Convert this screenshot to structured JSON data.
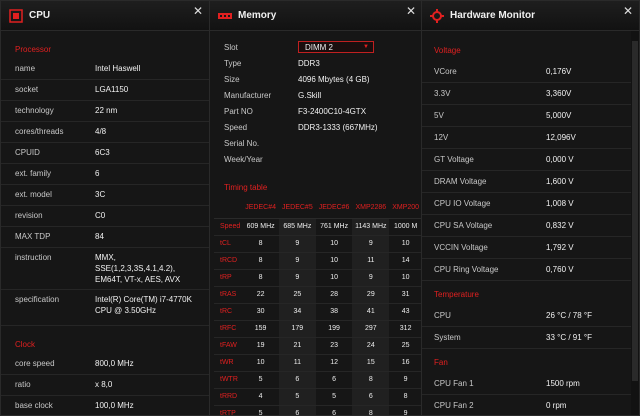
{
  "cpu": {
    "title": "CPU",
    "processor_section": "Processor",
    "rows": [
      {
        "key": "name",
        "value": "Intel Haswell"
      },
      {
        "key": "socket",
        "value": "LGA1150"
      },
      {
        "key": "technology",
        "value": "22 nm"
      },
      {
        "key": "cores/threads",
        "value": "4/8"
      },
      {
        "key": "CPUID",
        "value": "6C3"
      },
      {
        "key": "ext. family",
        "value": "6"
      },
      {
        "key": "ext. model",
        "value": "3C"
      },
      {
        "key": "revision",
        "value": "C0"
      },
      {
        "key": "MAX TDP",
        "value": "84"
      },
      {
        "key": "instruction",
        "value": "MMX, SSE(1,2,3,3S,4.1,4.2), EM64T, VT-x, AES, AVX"
      },
      {
        "key": "specification",
        "value": "Intel(R) Core(TM) i7-4770K CPU @ 3.50GHz"
      }
    ],
    "clock_section": "Clock",
    "clock_rows": [
      {
        "key": "core speed",
        "value": "800,0 MHz"
      },
      {
        "key": "ratio",
        "value": "x 8,0"
      },
      {
        "key": "base clock",
        "value": "100,0 MHz"
      }
    ]
  },
  "memory": {
    "title": "Memory",
    "slot_label": "Slot",
    "slot_value": "DIMM 2",
    "rows": [
      {
        "key": "Type",
        "value": "DDR3"
      },
      {
        "key": "Size",
        "value": "4096 Mbytes (4 GB)"
      },
      {
        "key": "Manufacturer",
        "value": "G.Skill"
      },
      {
        "key": "Part NO",
        "value": "F3-2400C10-4GTX"
      },
      {
        "key": "Speed",
        "value": "DDR3-1333 (667MHz)"
      },
      {
        "key": "Serial No.",
        "value": ""
      },
      {
        "key": "Week/Year",
        "value": ""
      }
    ],
    "timing_section": "Timing table",
    "timing_headers": [
      "",
      "JEDEC#4",
      "JEDEC#5",
      "JEDEC#6",
      "XMP2286",
      "XMP200"
    ],
    "timing_rows": [
      {
        "label": "Speed",
        "values": [
          "609 MHz",
          "685 MHz",
          "761 MHz",
          "1143 MHz",
          "1000 M"
        ]
      },
      {
        "label": "tCL",
        "values": [
          "8",
          "9",
          "10",
          "9",
          "10"
        ]
      },
      {
        "label": "tRCD",
        "values": [
          "8",
          "9",
          "10",
          "11",
          "14"
        ]
      },
      {
        "label": "tRP",
        "values": [
          "8",
          "9",
          "10",
          "9",
          "10"
        ]
      },
      {
        "label": "tRAS",
        "values": [
          "22",
          "25",
          "28",
          "29",
          "31"
        ]
      },
      {
        "label": "tRC",
        "values": [
          "30",
          "34",
          "38",
          "41",
          "43"
        ]
      },
      {
        "label": "tRFC",
        "values": [
          "159",
          "179",
          "199",
          "297",
          "312"
        ]
      },
      {
        "label": "tFAW",
        "values": [
          "19",
          "21",
          "23",
          "24",
          "25"
        ]
      },
      {
        "label": "tWR",
        "values": [
          "10",
          "11",
          "12",
          "15",
          "16"
        ]
      },
      {
        "label": "tWTR",
        "values": [
          "5",
          "6",
          "6",
          "8",
          "9"
        ]
      },
      {
        "label": "tRRD",
        "values": [
          "4",
          "5",
          "5",
          "6",
          "8"
        ]
      },
      {
        "label": "tRTP",
        "values": [
          "5",
          "6",
          "6",
          "8",
          "9"
        ]
      }
    ]
  },
  "hw": {
    "title": "Hardware Monitor",
    "voltage_section": "Voltage",
    "voltage_rows": [
      {
        "key": "VCore",
        "value": "0,176V"
      },
      {
        "key": "3.3V",
        "value": "3,360V"
      },
      {
        "key": "5V",
        "value": "5,000V"
      },
      {
        "key": "12V",
        "value": "12,096V"
      },
      {
        "key": "GT Voltage",
        "value": "0,000 V"
      },
      {
        "key": "DRAM Voltage",
        "value": "1,600 V"
      },
      {
        "key": "CPU IO Voltage",
        "value": "1,008 V"
      },
      {
        "key": "CPU SA Voltage",
        "value": "0,832 V"
      },
      {
        "key": "VCCIN Voltage",
        "value": "1,792 V"
      },
      {
        "key": "CPU Ring Voltage",
        "value": "0,760 V"
      }
    ],
    "temp_section": "Temperature",
    "temp_rows": [
      {
        "key": "CPU",
        "value": "26 °C / 78 °F"
      },
      {
        "key": "System",
        "value": "33 °C / 91 °F"
      }
    ],
    "fan_section": "Fan",
    "fan_rows": [
      {
        "key": "CPU Fan 1",
        "value": "1500 rpm"
      },
      {
        "key": "CPU Fan 2",
        "value": "0 rpm"
      }
    ]
  },
  "close_glyph": "✕",
  "colors": {
    "accent": "#e02020",
    "background": "#161616"
  }
}
